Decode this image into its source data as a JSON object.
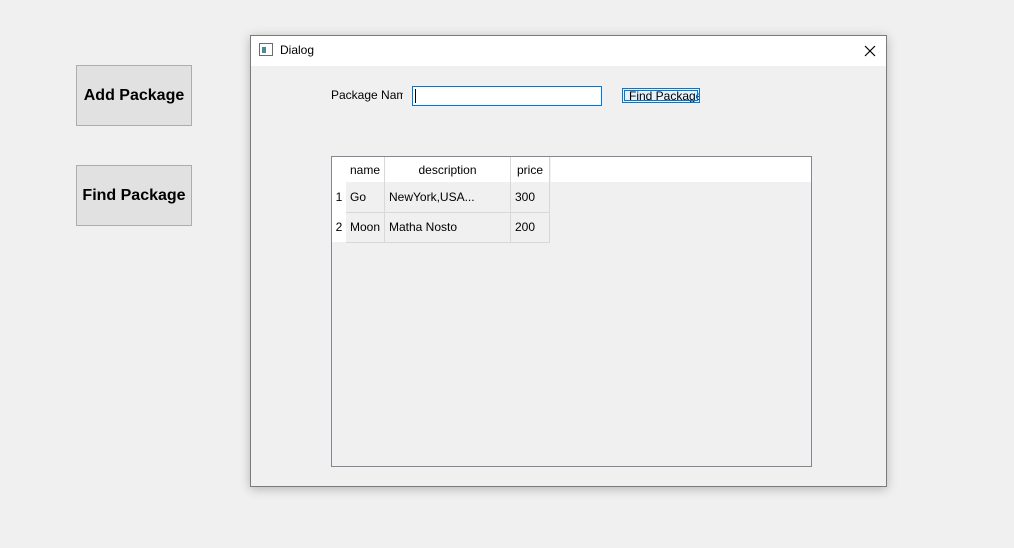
{
  "main_window": {
    "add_package_label": "Add Package",
    "find_package_label": "Find Package"
  },
  "dialog": {
    "title": "Dialog",
    "package_name_label": "Package Nam",
    "package_name_value": "",
    "find_button_label": "Find Package",
    "table": {
      "columns": [
        "name",
        "description",
        "price"
      ],
      "rows": [
        {
          "row_number": "1",
          "name": "Go",
          "description": "NewYork,USA...",
          "price": "300"
        },
        {
          "row_number": "2",
          "name": "Moon",
          "description": "Matha Nosto",
          "price": "200"
        }
      ]
    }
  },
  "icons": {
    "dialog_icon": "window-icon",
    "close_icon": "close-icon"
  }
}
